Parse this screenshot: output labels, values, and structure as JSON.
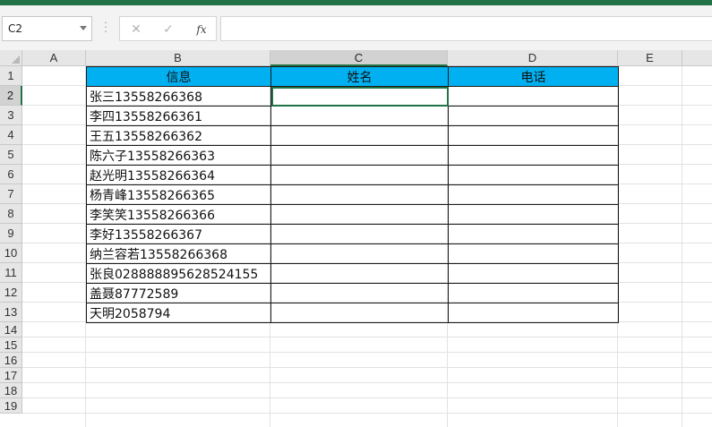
{
  "name_box": {
    "value": "C2"
  },
  "formula_bar": {
    "cancel": "✕",
    "confirm": "✓",
    "function": "fx",
    "value": ""
  },
  "columns": [
    "A",
    "B",
    "C",
    "D",
    "E"
  ],
  "rows": [
    "1",
    "2",
    "3",
    "4",
    "5",
    "6",
    "7",
    "8",
    "9",
    "10",
    "11",
    "12",
    "13",
    "14",
    "15",
    "16",
    "17",
    "18",
    "19"
  ],
  "table": {
    "header": [
      "信息",
      "姓名",
      "电话"
    ],
    "rows": [
      [
        "张三13558266368",
        "",
        ""
      ],
      [
        "李四13558266361",
        "",
        ""
      ],
      [
        "王五13558266362",
        "",
        ""
      ],
      [
        "陈六子13558266363",
        "",
        ""
      ],
      [
        "赵光明13558266364",
        "",
        ""
      ],
      [
        "杨青峰13558266365",
        "",
        ""
      ],
      [
        "李笑笑13558266366",
        "",
        ""
      ],
      [
        "李好13558266367",
        "",
        ""
      ],
      [
        "纳兰容若13558266368",
        "",
        ""
      ],
      [
        "张良028888895628524155",
        "",
        ""
      ],
      [
        "盖聂87772589",
        "",
        ""
      ],
      [
        "天明2058794",
        "",
        ""
      ]
    ]
  },
  "colors": {
    "accent": "#217346",
    "header_fill": "#00b0f0"
  }
}
